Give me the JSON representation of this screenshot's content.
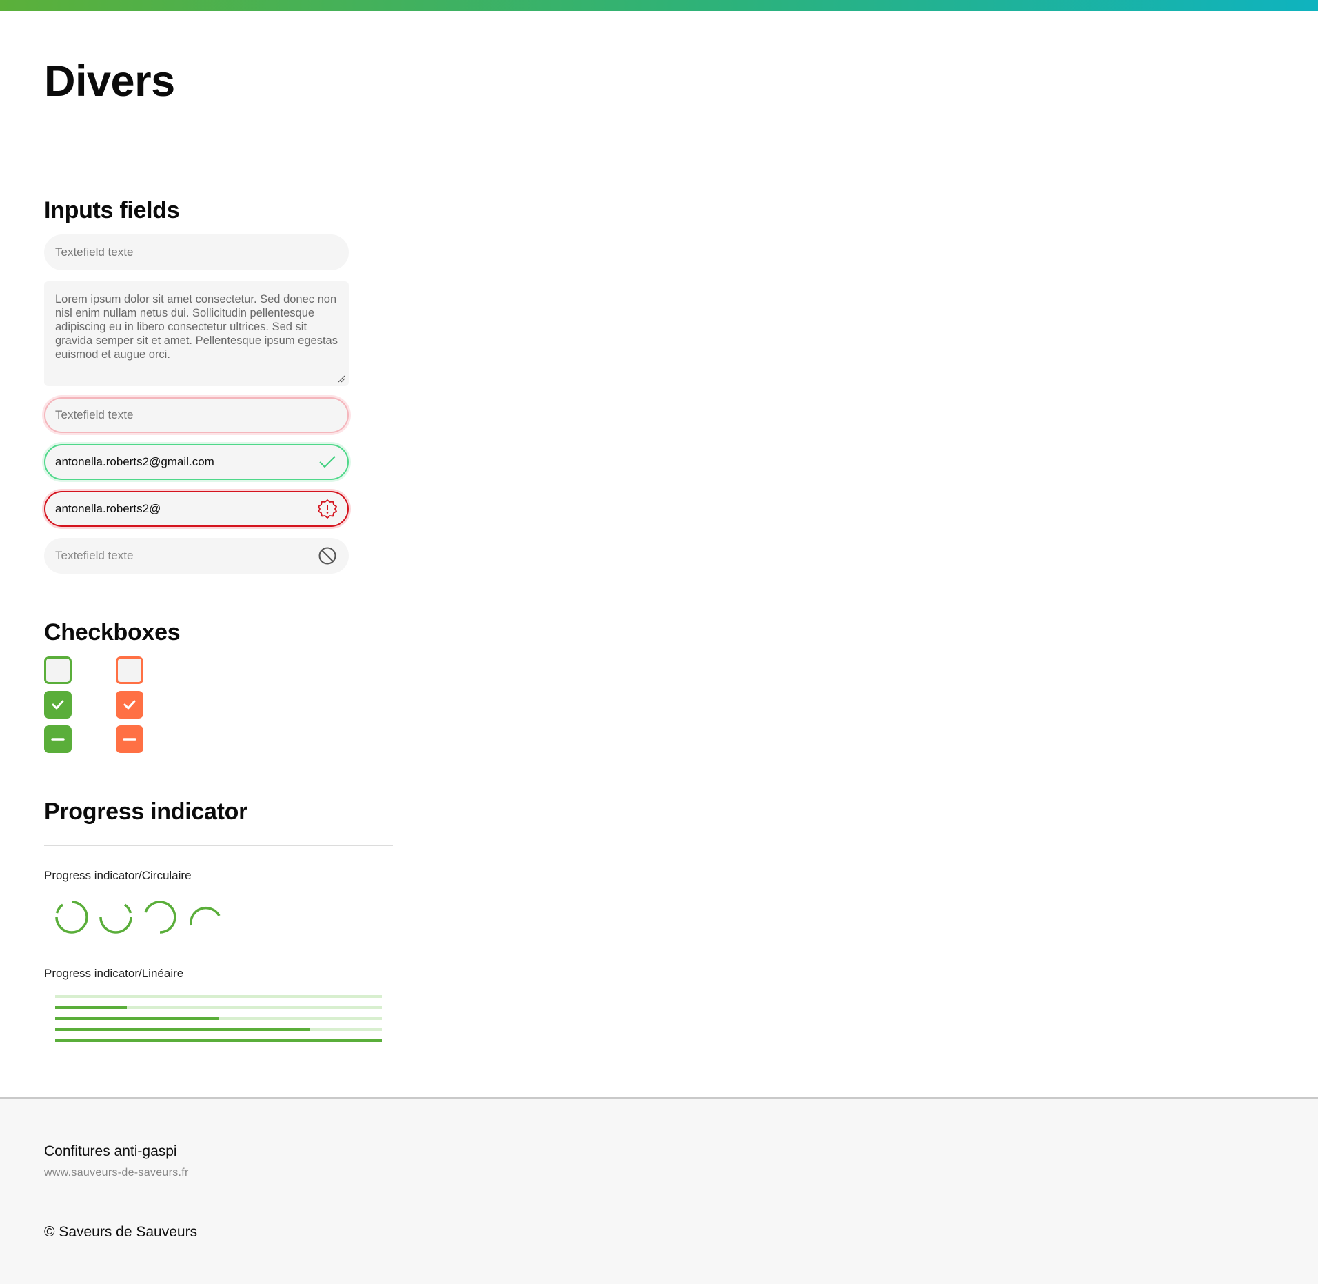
{
  "page": {
    "title": "Divers"
  },
  "colors": {
    "accent_green": "#5aae3a",
    "accent_orange": "#ff7044",
    "error_red": "#d4141e",
    "valid_green": "#4fd88a"
  },
  "inputs": {
    "title": "Inputs fields",
    "default_placeholder": "Textefield texte",
    "textarea_value": "Lorem ipsum dolor sit amet consectetur. Sed donec non nisl enim nullam netus dui. Sollicitudin pellentesque adipiscing eu in libero consectetur ultrices. Sed sit gravida semper sit et amet. Pellentesque ipsum egestas euismod et augue orci.",
    "focus_placeholder": "Textefield texte",
    "valid_value": "antonella.roberts2@gmail.com",
    "valid_icon": "check-icon",
    "invalid_value": "antonella.roberts2@",
    "invalid_icon": "alert-badge-icon",
    "disabled_placeholder": "Textefield texte",
    "disabled_icon": "blocked-icon"
  },
  "checkboxes": {
    "title": "Checkboxes",
    "columns": [
      {
        "color": "green",
        "states": [
          "unchecked",
          "checked",
          "indeterminate"
        ]
      },
      {
        "color": "orange",
        "states": [
          "unchecked",
          "checked",
          "indeterminate"
        ]
      }
    ]
  },
  "progress": {
    "title": "Progress indicator",
    "circular_label": "Progress indicator/Circulaire",
    "linear_label": "Progress indicator/Linéaire",
    "linear_values": [
      0,
      0.22,
      0.5,
      0.78,
      1.0
    ]
  },
  "footer": {
    "title": "Confitures anti-gaspi",
    "url": "www.sauveurs-de-saveurs.fr",
    "copyright": "© Saveurs de Sauveurs"
  }
}
